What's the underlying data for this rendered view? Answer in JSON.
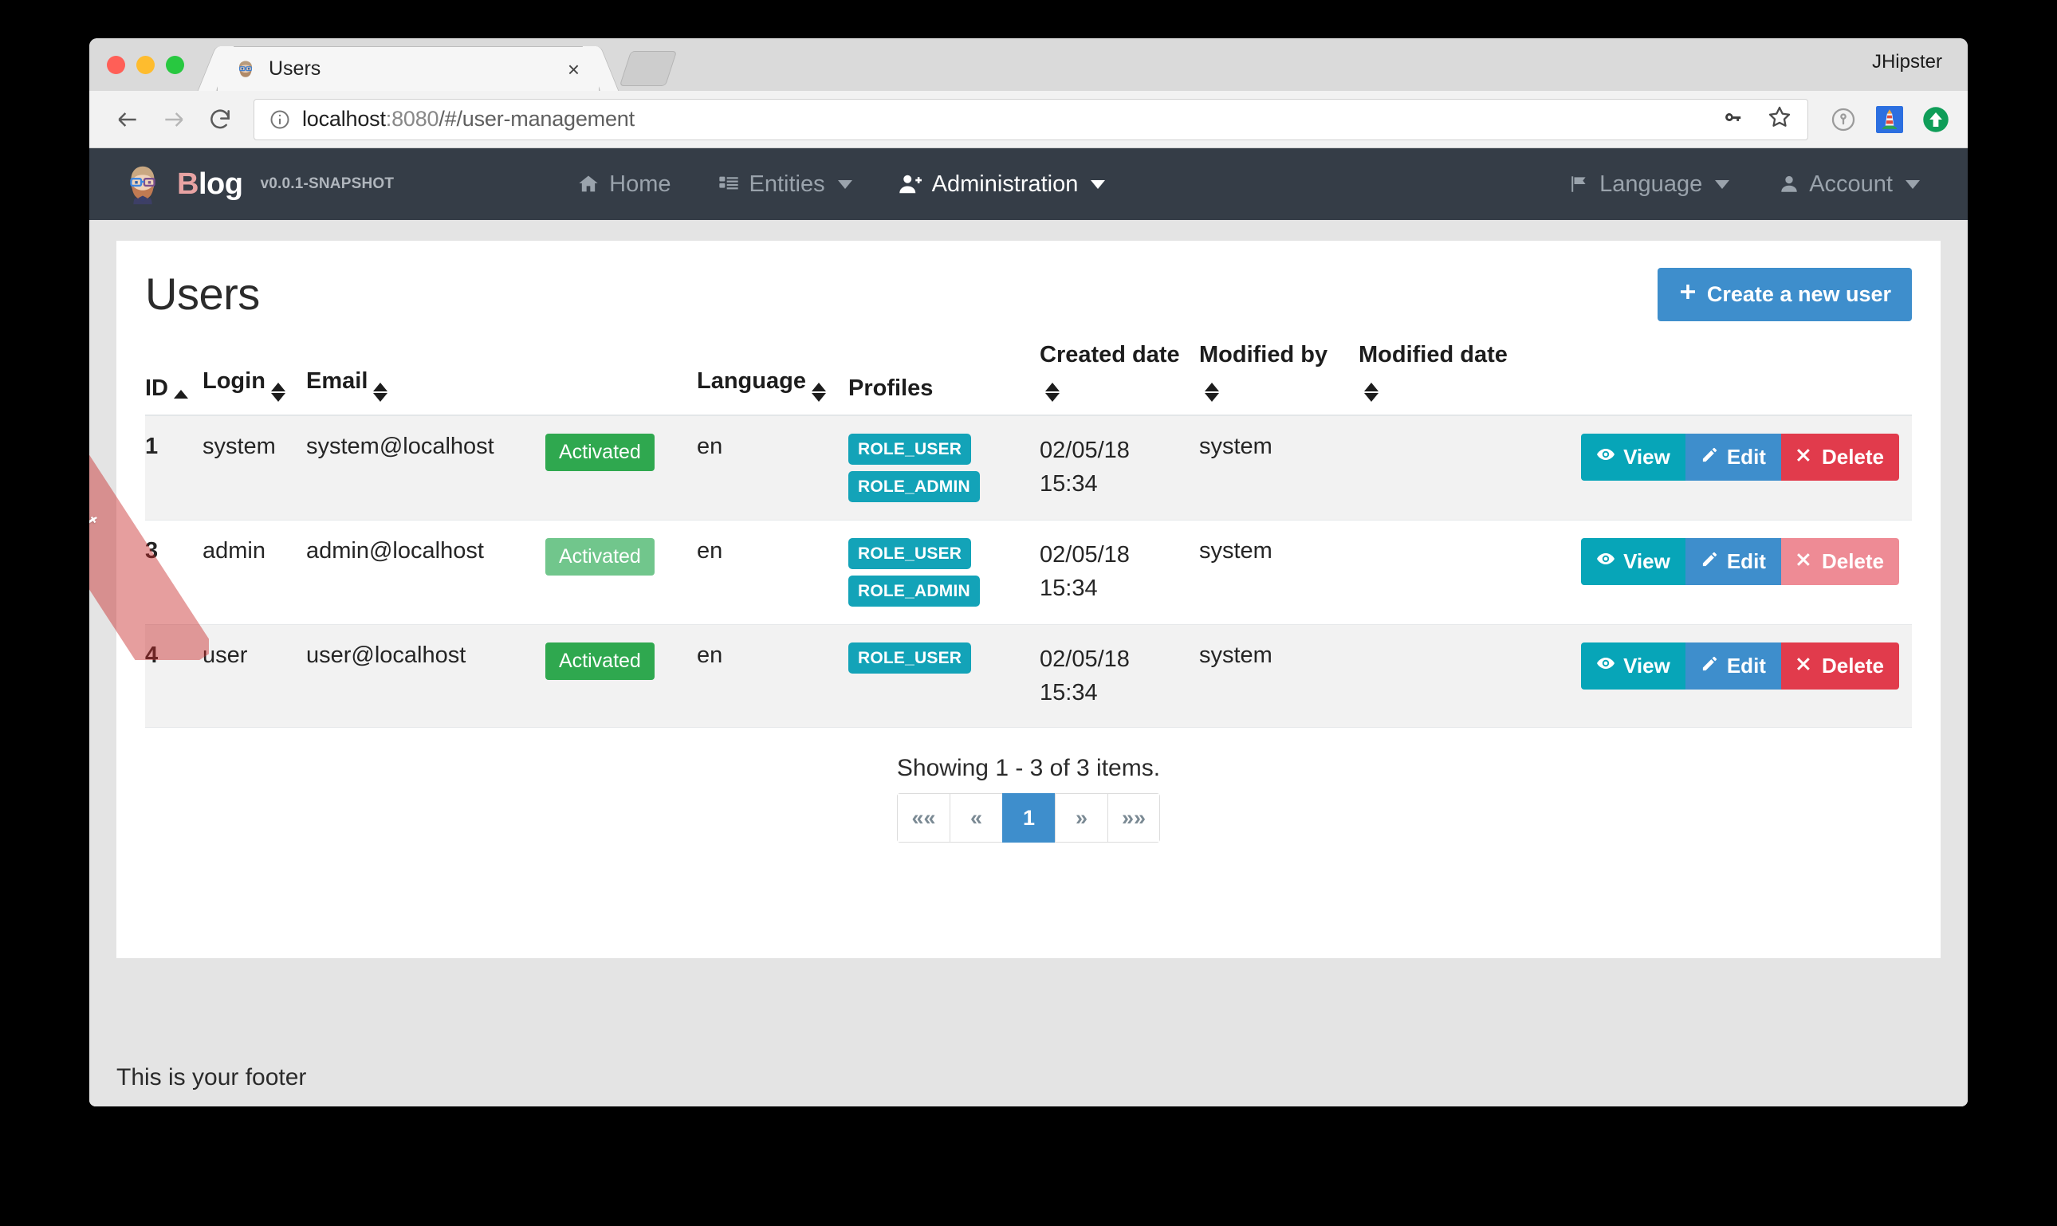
{
  "browser": {
    "tab": {
      "title": "Users",
      "favicon": "jhipster-avatar-icon",
      "close_label": "×"
    },
    "new_tab_label": "+",
    "profile_name": "JHipster",
    "nav": {
      "back": "←",
      "forward": "→",
      "reload": "⟳"
    },
    "url": {
      "scheme_info": "info-icon",
      "host": "localhost",
      "port": ":8080",
      "path": "/#/user-management",
      "full": "localhost:8080/#/user-management"
    },
    "omnibox_icons": [
      "key-icon",
      "star-icon"
    ],
    "extension_icons": [
      "onepassword-icon",
      "lighthouse-icon",
      "upload-green-icon"
    ]
  },
  "ribbon": {
    "label": "Development"
  },
  "navbar": {
    "brand": {
      "logo": "jhipster-avatar-icon",
      "name_prefix": "B",
      "name_rest": "log",
      "version": "v0.0.1-SNAPSHOT"
    },
    "center_items": [
      {
        "label": "Home",
        "icon": "home-icon",
        "caret": false,
        "active": false
      },
      {
        "label": "Entities",
        "icon": "list-icon",
        "caret": true,
        "active": false
      },
      {
        "label": "Administration",
        "icon": "user-plus-icon",
        "caret": true,
        "active": true
      }
    ],
    "right_items": [
      {
        "label": "Language",
        "icon": "flag-icon",
        "caret": true,
        "active": false
      },
      {
        "label": "Account",
        "icon": "user-icon",
        "caret": true,
        "active": false
      }
    ]
  },
  "page": {
    "title": "Users",
    "create_button": {
      "label": "Create a new user",
      "icon": "plus-icon"
    }
  },
  "table": {
    "columns": [
      {
        "label": "ID",
        "sort": "asc"
      },
      {
        "label": "Login",
        "sort": "both"
      },
      {
        "label": "Email",
        "sort": "both"
      },
      {
        "label": "",
        "sort": "none"
      },
      {
        "label": "Language",
        "sort": "both"
      },
      {
        "label": "Profiles",
        "sort": "none"
      },
      {
        "label": "Created date",
        "sort": "both"
      },
      {
        "label": "Modified by",
        "sort": "both"
      },
      {
        "label": "Modified date",
        "sort": "both"
      },
      {
        "label": "",
        "sort": "none"
      }
    ],
    "rows": [
      {
        "id": "1",
        "login": "system",
        "email": "system@localhost",
        "status": "Activated",
        "status_muted": false,
        "language": "en",
        "profiles": [
          "ROLE_USER",
          "ROLE_ADMIN"
        ],
        "created_date": "02/05/18 15:34",
        "modified_by": "system",
        "modified_date": "",
        "actions": {
          "view": "View",
          "edit": "Edit",
          "delete": "Delete",
          "delete_disabled": false
        }
      },
      {
        "id": "3",
        "login": "admin",
        "email": "admin@localhost",
        "status": "Activated",
        "status_muted": true,
        "language": "en",
        "profiles": [
          "ROLE_USER",
          "ROLE_ADMIN"
        ],
        "created_date": "02/05/18 15:34",
        "modified_by": "system",
        "modified_date": "",
        "actions": {
          "view": "View",
          "edit": "Edit",
          "delete": "Delete",
          "delete_disabled": true
        }
      },
      {
        "id": "4",
        "login": "user",
        "email": "user@localhost",
        "status": "Activated",
        "status_muted": false,
        "language": "en",
        "profiles": [
          "ROLE_USER"
        ],
        "created_date": "02/05/18 15:34",
        "modified_by": "system",
        "modified_date": "",
        "actions": {
          "view": "View",
          "edit": "Edit",
          "delete": "Delete",
          "delete_disabled": false
        }
      }
    ]
  },
  "pagination": {
    "info": "Showing 1 - 3 of 3 items.",
    "buttons": [
      {
        "label": "««",
        "name": "first-page",
        "active": false
      },
      {
        "label": "«",
        "name": "prev-page",
        "active": false
      },
      {
        "label": "1",
        "name": "page-1",
        "active": true
      },
      {
        "label": "»",
        "name": "next-page",
        "active": false
      },
      {
        "label": "»»",
        "name": "last-page",
        "active": false
      }
    ]
  },
  "footer": {
    "text": "This is your footer"
  },
  "colors": {
    "navbar_bg": "#353d47",
    "primary": "#3e8ecc",
    "info": "#07a5b8",
    "success": "#2fa84f",
    "danger": "#e13b4c",
    "badge": "#13a3b8",
    "id_link": "#5b4a18"
  }
}
